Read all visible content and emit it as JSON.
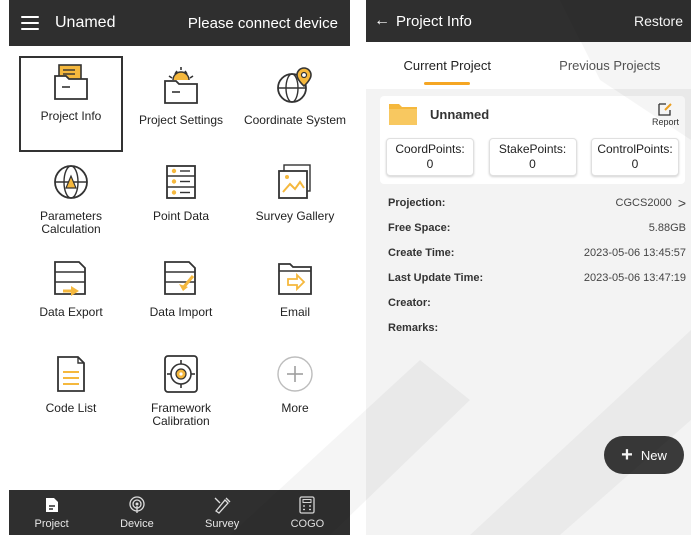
{
  "left": {
    "app_title": "Unamed",
    "connect_status": "Please connect device",
    "tiles": [
      {
        "label": "Project Info",
        "icon": "folder-doc-icon",
        "selected": true
      },
      {
        "label": "Project Settings",
        "icon": "folder-gear-icon"
      },
      {
        "label": "Coordinate System",
        "icon": "globe-pin-icon"
      },
      {
        "label": "Parameters Calculation",
        "icon": "globe-calc-icon"
      },
      {
        "label": "Point Data",
        "icon": "point-list-icon"
      },
      {
        "label": "Survey Gallery",
        "icon": "gallery-icon"
      },
      {
        "label": "Data Export",
        "icon": "data-export-icon"
      },
      {
        "label": "Data Import",
        "icon": "data-import-icon"
      },
      {
        "label": "Email",
        "icon": "email-export-icon"
      },
      {
        "label": "Code List",
        "icon": "code-list-icon"
      },
      {
        "label": "Framework Calibration",
        "icon": "target-calibration-icon"
      },
      {
        "label": "More",
        "icon": "plus-circle-icon"
      }
    ],
    "nav": [
      {
        "label": "Project",
        "icon": "project-icon"
      },
      {
        "label": "Device",
        "icon": "device-icon"
      },
      {
        "label": "Survey",
        "icon": "survey-icon"
      },
      {
        "label": "COGO",
        "icon": "calculator-icon"
      }
    ]
  },
  "right": {
    "title": "Project Info",
    "restore": "Restore",
    "tabs": [
      "Current Project",
      "Previous Projects"
    ],
    "project_name": "Unnamed",
    "report": "Report",
    "points": [
      {
        "label": "CoordPoints:",
        "value": "0"
      },
      {
        "label": "StakePoints:",
        "value": "0"
      },
      {
        "label": "ControlPoints:",
        "value": "0"
      }
    ],
    "info": [
      {
        "label": "Projection:",
        "value": "CGCS2000",
        "chevron": ">"
      },
      {
        "label": "Free Space:",
        "value": "5.88GB"
      },
      {
        "label": "Create Time:",
        "value": "2023-05-06 13:45:57"
      },
      {
        "label": "Last Update Time:",
        "value": "2023-05-06 13:47:19"
      },
      {
        "label": "Creator:",
        "value": ""
      },
      {
        "label": "Remarks:",
        "value": ""
      }
    ],
    "new_button": "New"
  },
  "colors": {
    "dark_bar": "#2f2f2f",
    "accent": "#f5a623",
    "folder": "#f5b83d"
  }
}
